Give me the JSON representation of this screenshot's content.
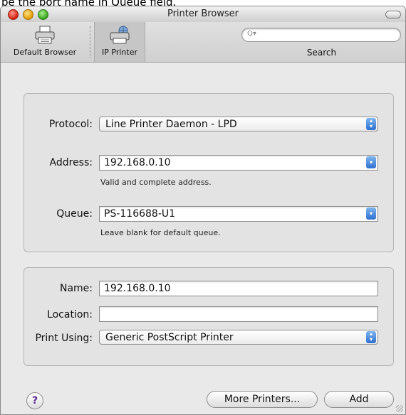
{
  "caption": "pe the port name in Queue field.",
  "window": {
    "title": "Printer Browser"
  },
  "toolbar": {
    "default_browser": {
      "label": "Default Browser",
      "icon": "printer-icon"
    },
    "ip_printer": {
      "label": "IP Printer",
      "icon": "network-printer-icon"
    },
    "search": {
      "label": "Search",
      "placeholder": "",
      "icon": "search-icon"
    }
  },
  "connection": {
    "protocol": {
      "label": "Protocol:",
      "value": "Line Printer Daemon - LPD"
    },
    "address": {
      "label": "Address:",
      "value": "192.168.0.10",
      "hint": "Valid and complete address."
    },
    "queue": {
      "label": "Queue:",
      "value": "PS-116688-U1",
      "hint": "Leave blank for default queue."
    }
  },
  "details": {
    "name": {
      "label": "Name:",
      "value": "192.168.0.10"
    },
    "location": {
      "label": "Location:",
      "value": ""
    },
    "print_using": {
      "label": "Print Using:",
      "value": "Generic PostScript Printer"
    }
  },
  "footer": {
    "help": "?",
    "more_printers": "More Printers...",
    "add": "Add"
  }
}
